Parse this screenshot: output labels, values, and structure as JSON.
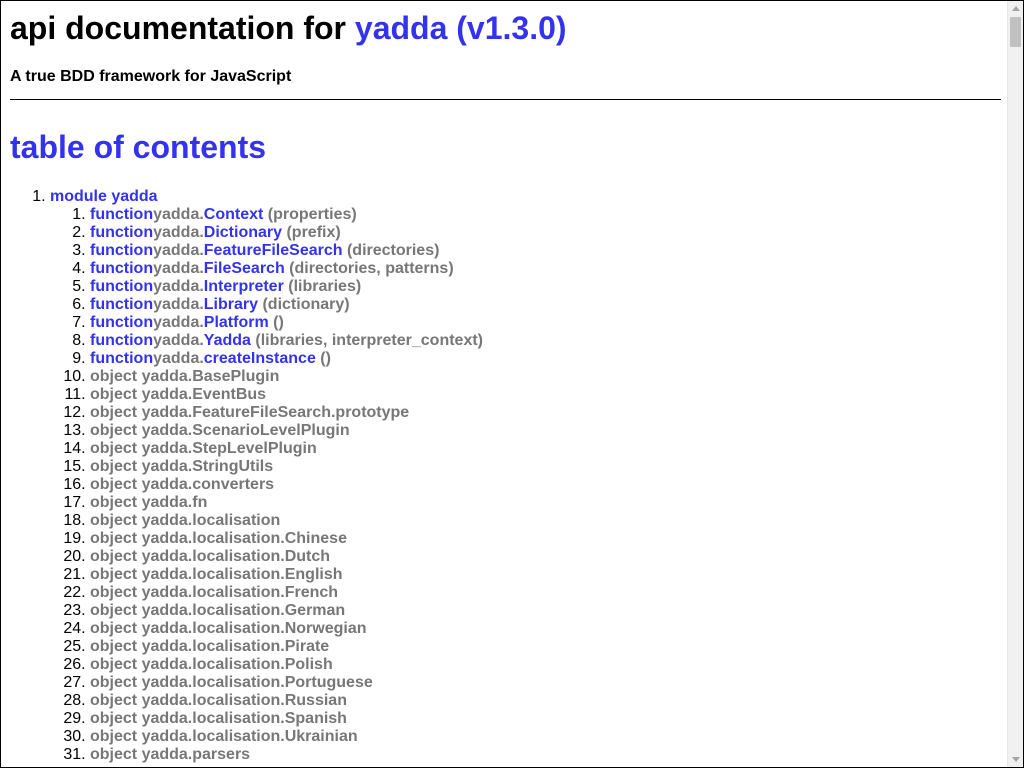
{
  "header": {
    "title_prefix": "api documentation for ",
    "title_project": "yadda (v1.3.0)",
    "subtitle": "A true BDD framework for JavaScript"
  },
  "toc": {
    "heading": "table of contents",
    "module_label": "module yadda",
    "functions": [
      {
        "kw": "function",
        "ns": "yadda.",
        "name": "Context",
        "args": " (properties)"
      },
      {
        "kw": "function",
        "ns": "yadda.",
        "name": "Dictionary",
        "args": " (prefix)"
      },
      {
        "kw": "function",
        "ns": "yadda.",
        "name": "FeatureFileSearch",
        "args": " (directories)"
      },
      {
        "kw": "function",
        "ns": "yadda.",
        "name": "FileSearch",
        "args": " (directories, patterns)"
      },
      {
        "kw": "function",
        "ns": "yadda.",
        "name": "Interpreter",
        "args": " (libraries)"
      },
      {
        "kw": "function",
        "ns": "yadda.",
        "name": "Library",
        "args": " (dictionary)"
      },
      {
        "kw": "function",
        "ns": "yadda.",
        "name": "Platform",
        "args": " ()"
      },
      {
        "kw": "function",
        "ns": "yadda.",
        "name": "Yadda",
        "args": " (libraries, interpreter_context)"
      },
      {
        "kw": "function",
        "ns": "yadda.",
        "name": "createInstance",
        "args": " ()"
      }
    ],
    "objects": [
      "object yadda.BasePlugin",
      "object yadda.EventBus",
      "object yadda.FeatureFileSearch.prototype",
      "object yadda.ScenarioLevelPlugin",
      "object yadda.StepLevelPlugin",
      "object yadda.StringUtils",
      "object yadda.converters",
      "object yadda.fn",
      "object yadda.localisation",
      "object yadda.localisation.Chinese",
      "object yadda.localisation.Dutch",
      "object yadda.localisation.English",
      "object yadda.localisation.French",
      "object yadda.localisation.German",
      "object yadda.localisation.Norwegian",
      "object yadda.localisation.Pirate",
      "object yadda.localisation.Polish",
      "object yadda.localisation.Portuguese",
      "object yadda.localisation.Russian",
      "object yadda.localisation.Spanish",
      "object yadda.localisation.Ukrainian",
      "object yadda.parsers"
    ]
  },
  "colors": {
    "link": "#3333ee",
    "muted": "#777777"
  }
}
